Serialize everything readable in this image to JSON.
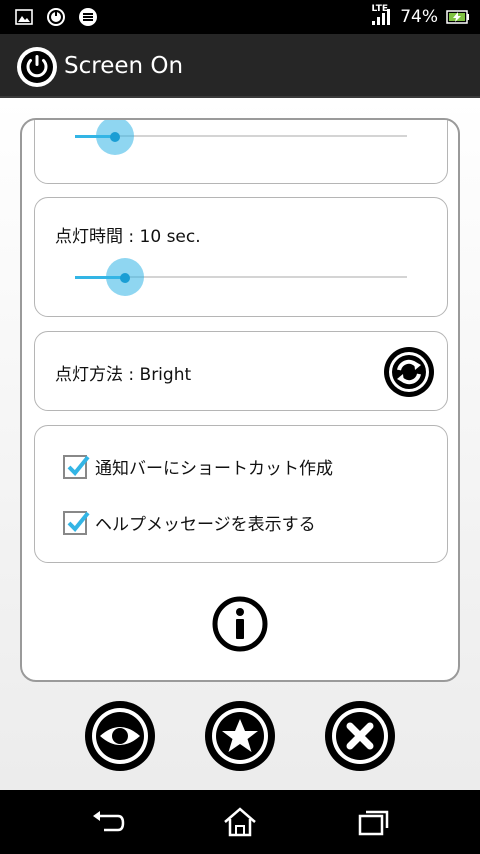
{
  "status_bar": {
    "battery_percent": "74%",
    "network": "LTE",
    "icons": [
      "gallery-icon",
      "screen-on-notify-icon",
      "sync-notify-icon",
      "signal-icon",
      "battery-charging-icon"
    ]
  },
  "app": {
    "title": "Screen On"
  },
  "settings": {
    "slider1": {
      "value_fraction": 0.12
    },
    "light_duration": {
      "label": "点灯時間 : 10 sec.",
      "value_fraction": 0.15
    },
    "light_method": {
      "label": "点灯方法 : Bright",
      "button_icon": "refresh-icon"
    },
    "checkboxes": [
      {
        "label": "通知バーにショートカット作成",
        "checked": true
      },
      {
        "label": "ヘルプメッセージを表示する",
        "checked": true
      }
    ]
  },
  "buttons": {
    "info": "info-icon",
    "bottom": [
      "eye-icon",
      "star-icon",
      "close-icon"
    ]
  },
  "nav_bar": {
    "buttons": [
      "back-icon",
      "home-icon",
      "recent-apps-icon"
    ]
  },
  "colors": {
    "accent": "#33b5e5",
    "action_bar": "#262626"
  }
}
